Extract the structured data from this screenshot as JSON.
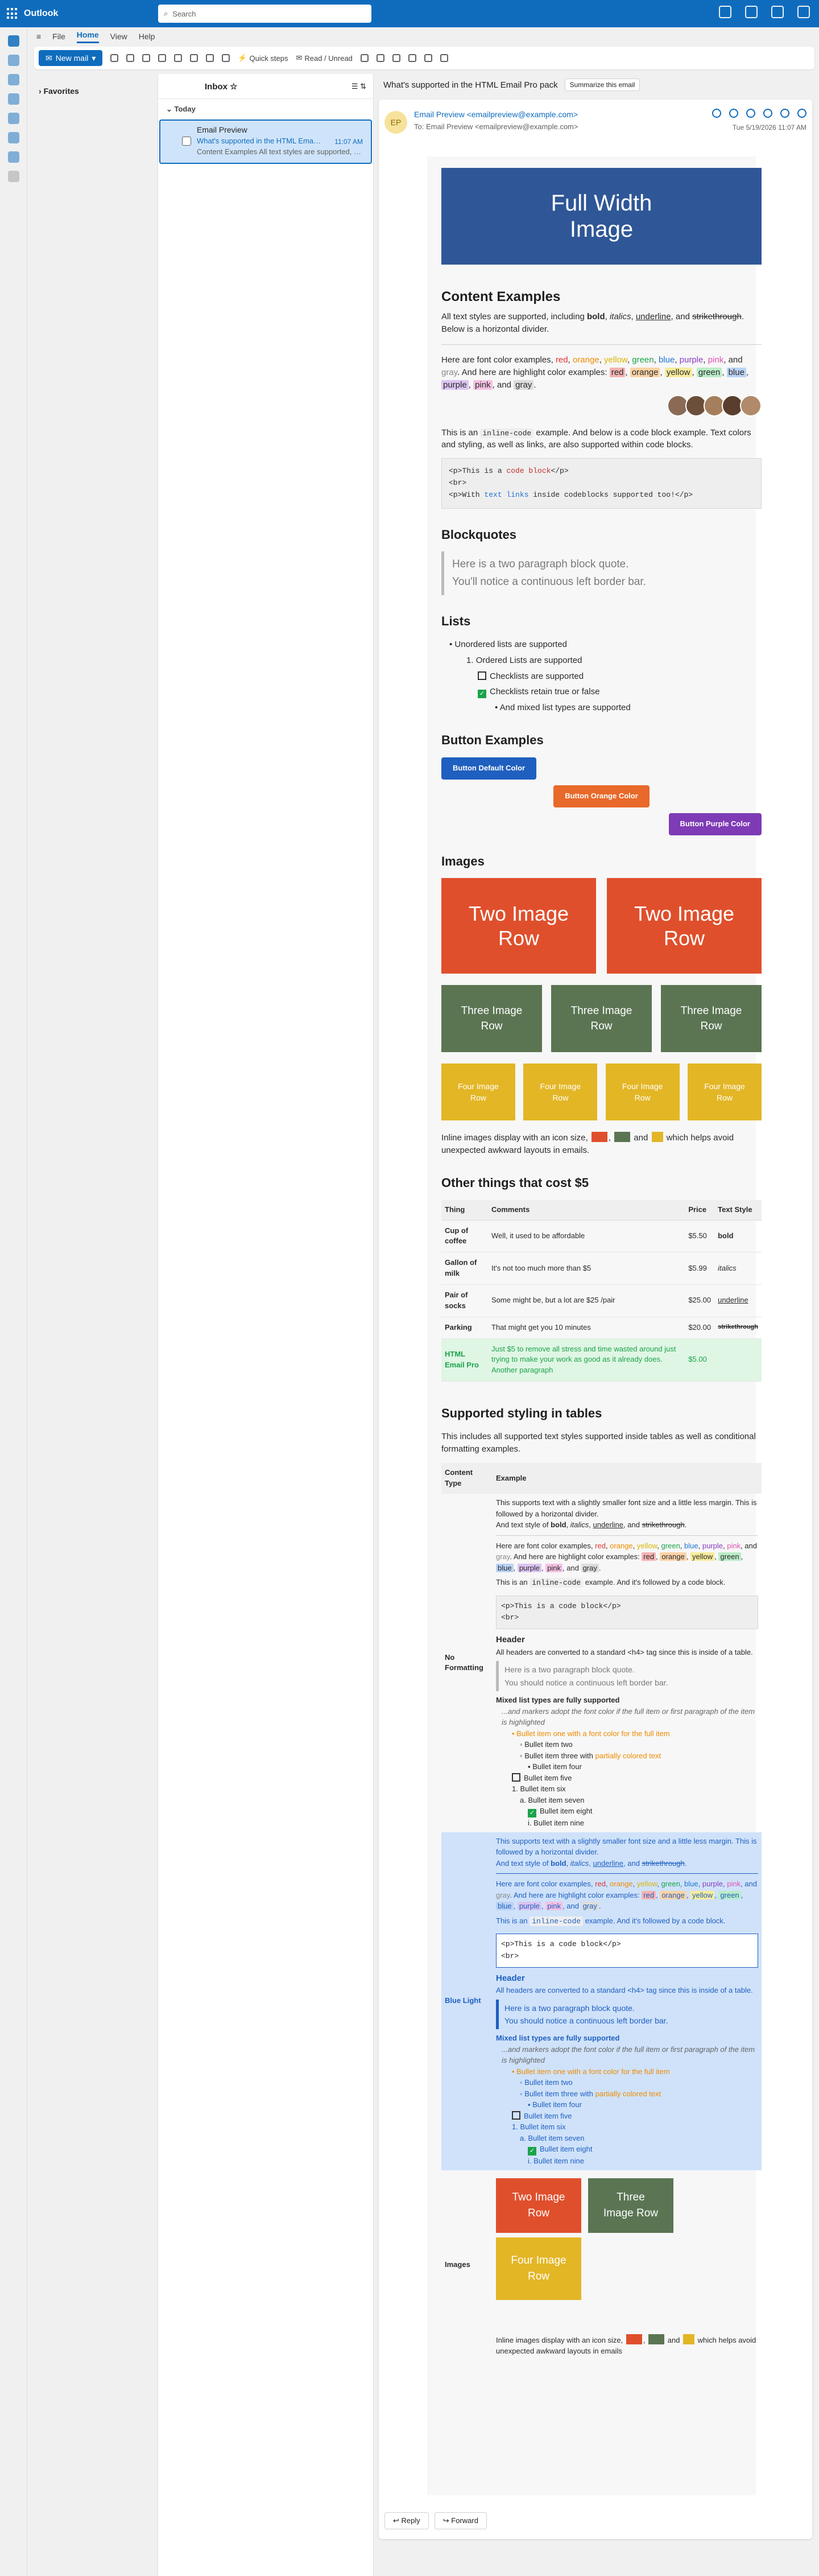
{
  "app": {
    "name": "Outlook",
    "search_placeholder": "Search"
  },
  "ribbon": {
    "tabs": [
      "File",
      "Home",
      "View",
      "Help"
    ],
    "new_mail": "New mail",
    "quick_steps": "Quick steps",
    "read_unread": "Read / Unread"
  },
  "folders": {
    "favorites": "Favorites"
  },
  "list": {
    "title": "Inbox",
    "group": "Today",
    "msg": {
      "from": "Email Preview",
      "subject": "What's supported in the HTML Email Pro pack",
      "time": "11:07 AM",
      "preview": "Content Examples All text styles are supported, including bold, italics"
    }
  },
  "reading": {
    "subject": "What's supported in the HTML Email Pro pack",
    "summarize": "Summarize this email",
    "avatar": "EP",
    "from": "Email Preview <emailpreview@example.com>",
    "to": "To: Email Preview <emailpreview@example.com>",
    "date": "Tue 5/19/2026 11:07 AM",
    "reply": "Reply",
    "forward": "Forward"
  },
  "email": {
    "hero": "Full Width Image",
    "content_h": "Content Examples",
    "intro": "All text styles are supported, including bold, italics, underline, and strikethrough. Below is a horizontal divider.",
    "colors_line": "Here are font color examples, red, orange, yellow, green, blue, purple, pink, and gray. And here are highlight color examples: red, orange, yellow, green, blue, purple, pink, and gray.",
    "inline_code": "This is an inline-code example. And below is a code block example. Text colors and styling, as well as links, are also supported within code blocks.",
    "code1": "<p>This is a code block</p>",
    "code2": "<br>",
    "code3": "<p>With text links inside codeblocks supported too!</p>",
    "bq_h": "Blockquotes",
    "bq1": "Here is a two paragraph block quote.",
    "bq2": "You'll notice a continuous left border bar.",
    "lists_h": "Lists",
    "l1": "Unordered lists are supported",
    "l2": "Ordered Lists are supported",
    "l3": "Checklists are supported",
    "l4": "Checklists retain true or false",
    "l5": "And mixed list types are supported",
    "btn_h": "Button Examples",
    "btn1": "Button Default Color",
    "btn2": "Button Orange Color",
    "btn3": "Button Purple Color",
    "img_h": "Images",
    "two": "Two Image Row",
    "three": "Three Image Row",
    "four": "Four Image Row",
    "inline_img": "Inline images display with an icon size, and which helps avoid unexpected awkward layouts in emails.",
    "cost_h": "Other things that cost $5",
    "cost_cols": [
      "Thing",
      "Comments",
      "Price",
      "Text Style"
    ],
    "cost_rows": [
      [
        "Cup of coffee",
        "Well, it used to be affordable",
        "$5.50",
        "bold"
      ],
      [
        "Gallon of milk",
        "It's not too much more than $5",
        "$5.99",
        "italics"
      ],
      [
        "Pair of socks",
        "Some might be, but a lot are $25 /pair",
        "$25.00",
        "underline"
      ],
      [
        "Parking",
        "That might get you 10 minutes",
        "$20.00",
        "strikethrough"
      ],
      [
        "HTML Email Pro",
        "Just $5 to remove all stress and time wasted around just trying to make your work as good as it already does. Another paragraph",
        "$5.00",
        ""
      ]
    ],
    "sty_h": "Supported styling in tables",
    "sty_intro": "This includes all supported text styles supported inside tables as well as conditional formatting examples.",
    "sty_cols": [
      "Content Type",
      "Example"
    ],
    "nf": "No Formatting",
    "bl": "Blue Light",
    "imgs": "Images",
    "t1": "This supports text with a slightly smaller font size and a little less margin. This is followed by a horizontal divider.",
    "t2": "And text style of bold, italics, underline, and strikethrough.",
    "t3": "Here are font color examples, red, orange, yellow, green, blue, purple, pink, and gray. And here are highlight color examples: red, orange, yellow, green, blue, purple, pink, and gray.",
    "t4": "This is an inline-code example. And it's followed by a code block.",
    "t5": "Header",
    "t6": "All headers are converted to a standard <h4> tag since this is inside of a table.",
    "t7": "Here is a two paragraph block quote.",
    "t8": "You should notice a continuous left border bar.",
    "t9": "Mixed list types are fully supported",
    "t10": "...and markers adopt the font color if the full item or first paragraph of the item is highlighted",
    "b1": "Bullet item one with a font color for the full item",
    "b2": "Bullet item two",
    "b3": "Bullet item three with partially colored text",
    "b4": "Bullet item four",
    "b5": "Bullet item five",
    "b6": "Bullet item six",
    "b7": "Bullet item seven",
    "b8": "Bullet item eight",
    "b9": "Bullet item nine",
    "inline2": "Inline images display with an icon size, and which helps avoid unexpected awkward layouts in emails"
  }
}
